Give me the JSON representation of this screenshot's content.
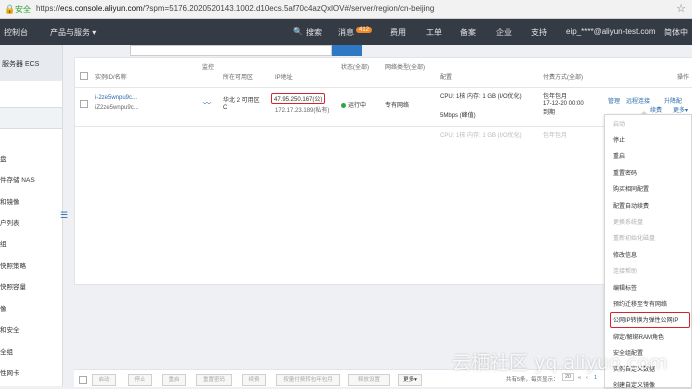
{
  "address_bar": {
    "secure_label": "安全",
    "url_prefix": "https://",
    "url_host": "ecs.console.aliyun.com",
    "url_rest": "/?spm=5176.2020520143.1002.d10ecs.5af70c4azQxlOV#/server/region/cn-beijing"
  },
  "topnav": {
    "console": "控制台",
    "products": "产品与服务 ▾",
    "search": "搜索",
    "messages": "消息",
    "messages_count": "412",
    "fees": "费用",
    "tickets": "工单",
    "filing": "备案",
    "enterprise": "企业",
    "support": "支持",
    "user": "eip_****@aliyun-test.com",
    "lang": "简体中"
  },
  "sidebar": {
    "title": "服务器 ECS",
    "items": [
      "盘",
      "件存储 NAS",
      "和镜像",
      "户列表",
      "组",
      "快照策略",
      "快照容量",
      "像",
      "和安全",
      "全组",
      "性网卡"
    ]
  },
  "table": {
    "headers": {
      "instance": "实例ID/名称",
      "monitor": "监控",
      "zone": "所在可用区",
      "ip": "IP地址",
      "status": "状态(全部)",
      "network": "网络类型(全部)",
      "config": "配置",
      "billing": "付费方式(全部)",
      "ops": "操作"
    },
    "row": {
      "instance_id": "i-2ze5wnpu9c...",
      "instance_name": "iZ2ze5wnpu9c...",
      "zone_line1": "华北 2 可用区",
      "zone_line2": "C",
      "public_ip": "47.95.250.167(公)",
      "private_ip": "172.17.23.189(私有)",
      "status": "运行中",
      "network": "专有网络",
      "cpu": "CPU:  1核    内存: 1 GB (I/O优化)",
      "bandwidth": "5Mbps (峰值)",
      "billing_type": "包年包月",
      "expire": "17-12-20 00:00 到期",
      "op_manage": "管理",
      "op_remote": "远程连接",
      "op_upgrade": "升降配",
      "op_renew": "续费",
      "op_more": "更多▾"
    },
    "row2_partial": {
      "cpu": "CPU:  1核    内存: 1 GB (I/O优化)",
      "billing_type": "包年包月"
    }
  },
  "more_menu": {
    "items": [
      {
        "label": "启动",
        "disabled": true
      },
      {
        "label": "停止",
        "disabled": false
      },
      {
        "label": "重启",
        "disabled": false
      },
      {
        "label": "重置密码",
        "disabled": false
      },
      {
        "label": "购买相同配置",
        "disabled": false
      },
      {
        "label": "配置自动续费",
        "disabled": false
      },
      {
        "label": "更换系统盘",
        "disabled": true
      },
      {
        "label": "重新初始化磁盘",
        "disabled": true
      },
      {
        "label": "修改信息",
        "disabled": false
      },
      {
        "label": "连接帮助",
        "disabled": true
      },
      {
        "label": "编辑标签",
        "disabled": false
      },
      {
        "label": "预约迁移至专有网络",
        "disabled": false
      },
      {
        "label": "公网IP转换为弹性公网IP",
        "disabled": false,
        "highlighted": true
      },
      {
        "label": "绑定/解绑RAM角色",
        "disabled": false
      },
      {
        "label": "安全组配置",
        "disabled": false
      },
      {
        "label": "实例自定义数据",
        "disabled": false
      },
      {
        "label": "创建自定义镜像",
        "disabled": false
      }
    ]
  },
  "bottom_bar": {
    "buttons": [
      "启动",
      "停止",
      "重启",
      "重置密码",
      "续费",
      "按量付费转包年包月",
      "释放设置",
      "更多▾"
    ],
    "pagination": "共有5条，每页显示：",
    "page_size": "20",
    "page_first": "«",
    "page_prev": "‹",
    "page_current": "1"
  },
  "watermark": "云栖社区 yq.aliyun.com",
  "colors": {
    "nav_bg": "#343b45",
    "accent": "#2f78c4",
    "highlight": "#d6242e",
    "status_running": "#2aa844",
    "badge": "#f08a24"
  }
}
